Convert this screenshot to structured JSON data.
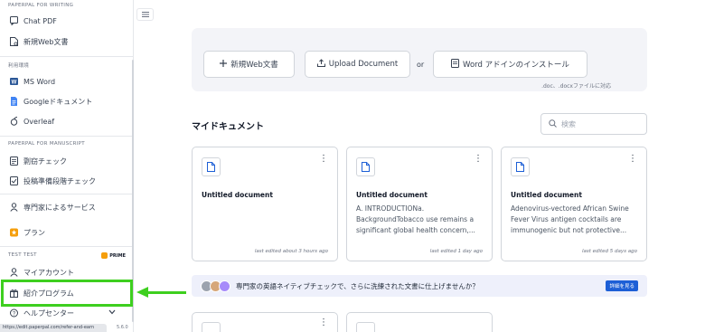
{
  "sidebar": {
    "writing_header": "PAPERPAL FOR WRITING",
    "chat_pdf": "Chat PDF",
    "new_web_doc": "新規Web文書",
    "env_header": "利用環境",
    "ms_word": "MS Word",
    "google_docs": "Googleドキュメント",
    "overleaf": "Overleaf",
    "manuscript_header": "PAPERPAL FOR MANUSCRIPT",
    "plagiarism_check": "剽窃チェック",
    "submission_check": "投稿準備段階チェック",
    "expert_services": "専門家によるサービス",
    "plan": "プラン",
    "user_header": "TEST TEST",
    "prime_label": "PRIME",
    "my_account": "マイアカウント",
    "referral_program": "紹介プログラム",
    "help_center": "ヘルプセンター",
    "status_url": "https://edit.paperpal.com/refer-and-earn",
    "version": "5.6.0"
  },
  "actions": {
    "new_web_doc": "新規Web文書",
    "upload_document": "Upload Document",
    "or": "or",
    "word_addin": "Word アドインのインストール",
    "note": ".doc、.docxファイルに対応"
  },
  "documents": {
    "header": "マイドキュメント",
    "search_placeholder": "検索",
    "cards": [
      {
        "title": "Untitled document",
        "excerpt": "",
        "edited": "last edited about 3 hours ago"
      },
      {
        "title": "Untitled document",
        "excerpt": "A. INTRODUCTIONa. BackgroundTobacco use remains a significant global health concern,...",
        "edited": "last edited 1 day ago"
      },
      {
        "title": "Untitled document",
        "excerpt": "Adenovirus-vectored African Swine Fever Virus antigen cocktails are immunogenic but not protective...",
        "edited": "last edited 5 days ago"
      }
    ]
  },
  "banner": {
    "text": "専門家の英語ネイティブチェックで、さらに洗練された文書に仕上げませんか？",
    "button": "詳細を見る"
  },
  "colors": {
    "highlight": "#3ecf1f",
    "accent_blue": "#1d5fd6",
    "plan_star": "#f59e0b"
  }
}
